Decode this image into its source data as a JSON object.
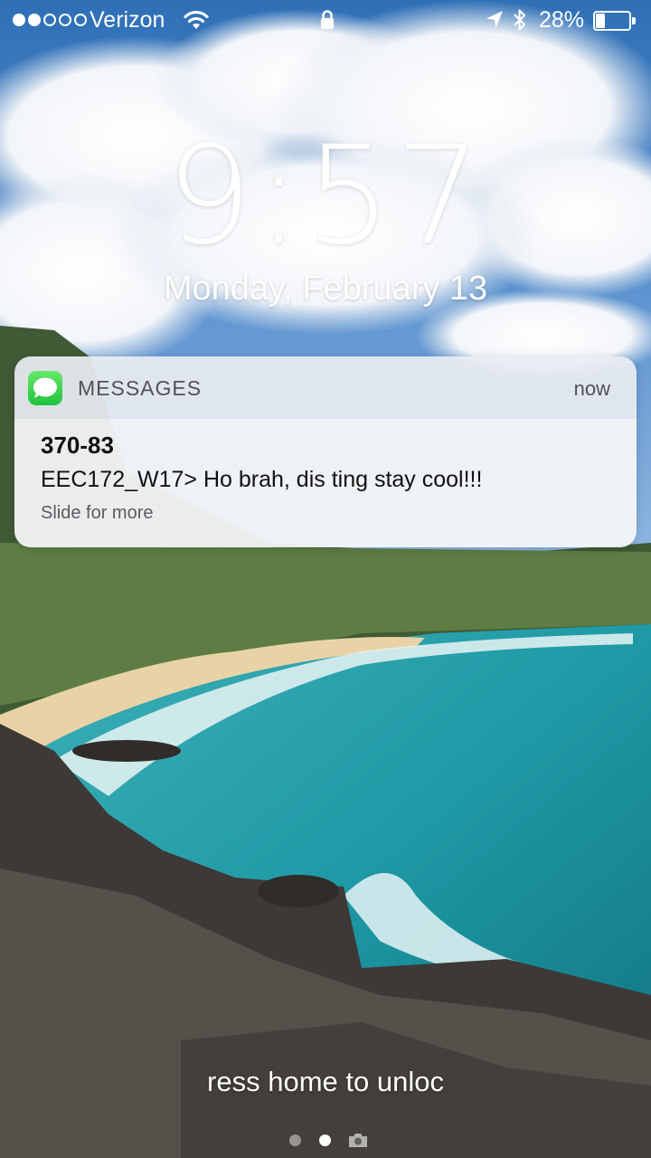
{
  "status_bar": {
    "signal_bars": 2,
    "signal_total": 5,
    "carrier": "Verizon",
    "battery_percent": "28%",
    "battery_level": 0.28
  },
  "lock_screen": {
    "time": "9:57",
    "date": "Monday, February 13",
    "unlock_hint": "ress home to unloc"
  },
  "notification": {
    "app_name": "MESSAGES",
    "app_icon": "messages-app-icon",
    "time": "now",
    "sender": "370-83",
    "message": "EEC172_W17> Ho brah, dis ting stay cool!!!",
    "hint": "Slide for more"
  },
  "page_indicator": {
    "pages": 2,
    "active_index": 1
  },
  "colors": {
    "messages_green": "#34c759",
    "text_dark": "#111111",
    "text_secondary": "#4f5257"
  }
}
